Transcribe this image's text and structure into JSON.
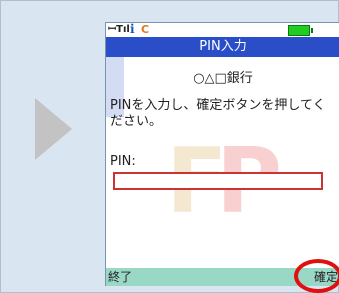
{
  "screen": {
    "title": "PIN入力",
    "bank_name": "○△□銀行",
    "instruction": "PINを入力し、確定ボタンを押してください。",
    "pin_label": "PIN:",
    "pin_value": ""
  },
  "softkeys": {
    "left_label": "終了",
    "right_label": "確定"
  },
  "icons": {
    "next_arrow": "play-arrow-icon",
    "signal": "antenna-signal-icon",
    "i_mode": "i-mode-icon",
    "carrier": "c-icon",
    "battery": "battery-icon"
  },
  "colors": {
    "panel_bg": "#d9e5f1",
    "title_bar": "#2a4ec8",
    "soft_bar": "#9ad8c6",
    "field_border": "#cc3333",
    "highlight": "#e01010"
  }
}
